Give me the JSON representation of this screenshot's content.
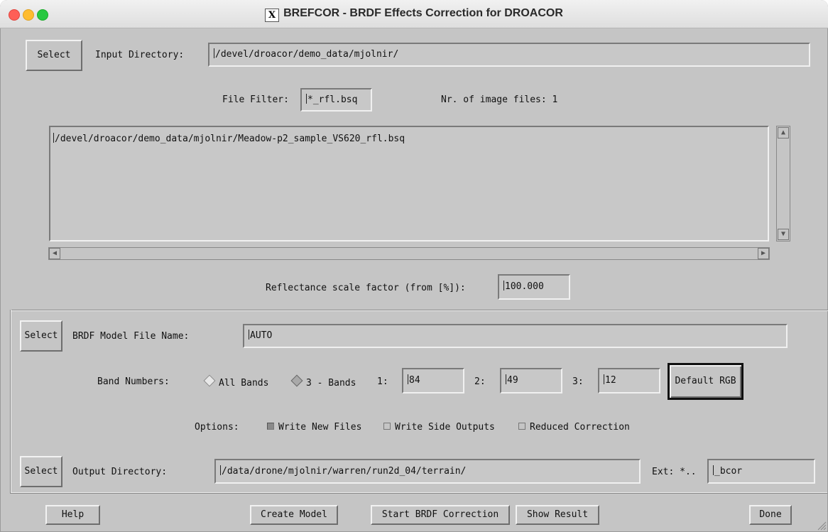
{
  "window": {
    "title": "BREFCOR - BRDF Effects Correction for DROACOR",
    "title_icon": "x-window-icon"
  },
  "input": {
    "select_label": "Select",
    "dir_label": "Input Directory:",
    "dir_value": "/devel/droacor/demo_data/mjolnir/",
    "filter_label": "File Filter:",
    "filter_value": "*_rfl.bsq",
    "count_text": "Nr. of image files: 1",
    "files": [
      "/devel/droacor/demo_data/mjolnir/Meadow-p2_sample_VS620_rfl.bsq"
    ],
    "scale_label": "Reflectance scale factor (from [%]):",
    "scale_value": "100.000"
  },
  "model": {
    "select_label": "Select",
    "file_label": "BRDF Model File Name:",
    "file_value": "AUTO",
    "band_label": "Band Numbers:",
    "all_bands_label": "All Bands",
    "three_bands_label": "3 - Bands",
    "band1_label": "1:",
    "band1_value": "84",
    "band2_label": "2:",
    "band2_value": "49",
    "band3_label": "3:",
    "band3_value": "12",
    "default_rgb_label": "Default RGB",
    "options_label": "Options:",
    "opt_write_new": "Write New Files",
    "opt_side_outputs": "Write Side Outputs",
    "opt_reduced": "Reduced Correction",
    "opt_write_new_checked": true,
    "opt_side_outputs_checked": false,
    "opt_reduced_checked": false,
    "selected_band_mode": "3 - Bands"
  },
  "output": {
    "select_label": "Select",
    "dir_label": "Output Directory:",
    "dir_value": "/data/drone/mjolnir/warren/run2d_04/terrain/",
    "ext_label": "Ext: *..",
    "ext_value": "_bcor"
  },
  "footer": {
    "help": "Help",
    "create_model": "Create Model",
    "start": "Start BRDF Correction",
    "show_result": "Show Result",
    "done": "Done"
  }
}
